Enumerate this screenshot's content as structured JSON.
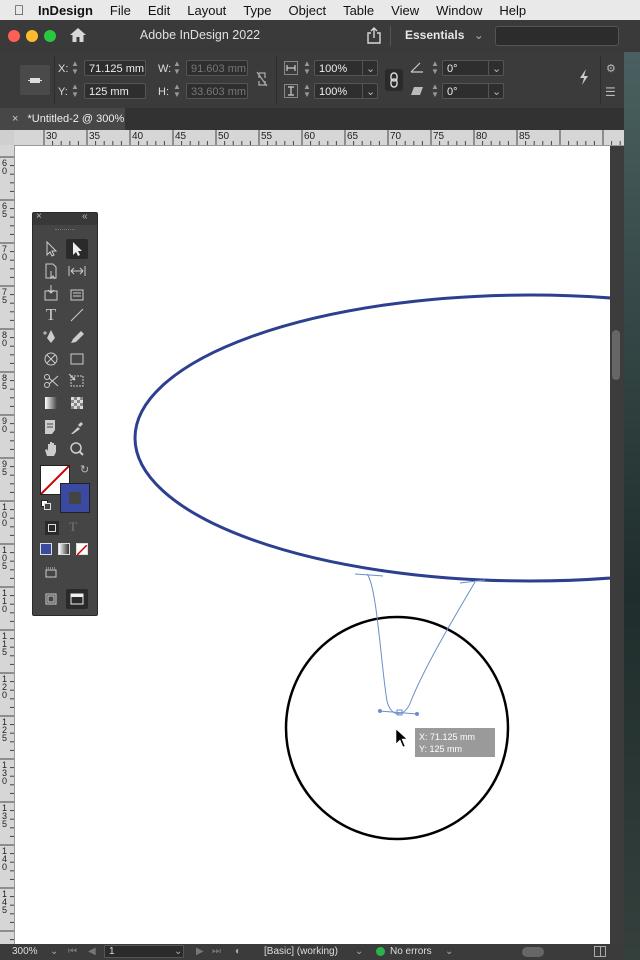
{
  "menubar": {
    "app": "InDesign",
    "items": [
      "File",
      "Edit",
      "Layout",
      "Type",
      "Object",
      "Table",
      "View",
      "Window",
      "Help"
    ]
  },
  "window": {
    "title": "Adobe InDesign 2022",
    "workspace": "Essentials"
  },
  "control": {
    "x_label": "X:",
    "x_value": "71.125 mm",
    "y_label": "Y:",
    "y_value": "125 mm",
    "w_label": "W:",
    "w_value": "91.603 mm",
    "h_label": "H:",
    "h_value": "33.603 mm",
    "scale_x": "100%",
    "scale_y": "100%",
    "rotate": "0°",
    "shear": "0°"
  },
  "tab": {
    "close": "×",
    "name": "*Untitled-2 @ 300%"
  },
  "ruler": {
    "h_ticks": [
      "30",
      "35",
      "40",
      "45",
      "50",
      "55",
      "60",
      "65",
      "70",
      "75",
      "80",
      "85"
    ],
    "v_ticks": [
      "60",
      "65",
      "70",
      "75",
      "80",
      "85",
      "90",
      "95",
      "100",
      "105",
      "110",
      "115",
      "120",
      "125",
      "130",
      "135",
      "140",
      "145"
    ]
  },
  "tooltip": {
    "x": "X: 71.125 mm",
    "y": "Y: 125 mm"
  },
  "status": {
    "zoom": "300%",
    "page": "1",
    "preflight_profile": "[Basic] (working)",
    "errors": "No errors"
  },
  "colors": {
    "ellipse_stroke": "#2d3f8f",
    "path_stroke": "#6a8fc9",
    "circle_stroke": "#000000",
    "fill_swatch": "#3a4aa0",
    "ok_green": "#2bb34a"
  }
}
